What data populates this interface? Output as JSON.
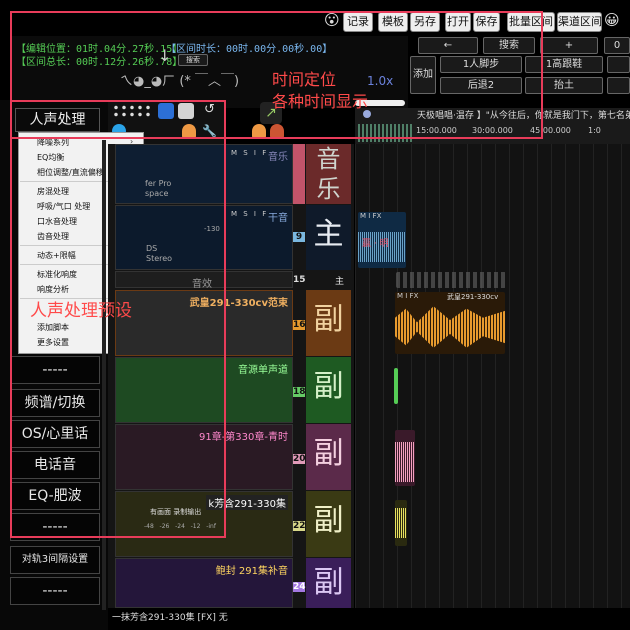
{
  "toolbar": {
    "buttons": [
      "记录",
      "模板",
      "另存",
      "打开",
      "保存",
      "批量区间",
      "渠道区间"
    ],
    "emoji_left": "😮",
    "emoji_right": "😀"
  },
  "info": {
    "edit_pos": "【编辑位置：01时.04分.27秒.15】",
    "interval_len": "【区间时长：00时.00分.00秒.00】",
    "total_len": "【区间总长：00时.12分.26秒.78】",
    "search_small": "搜索",
    "kaomoji": "ㄟ◕_◕ㄏ  (* ￣︿￣)",
    "speed": "1.0x"
  },
  "controls": {
    "left_arrow": "←",
    "search": "搜索",
    "plus": "+",
    "cut_label": "0",
    "add": "添加",
    "row1": [
      "1人脚步",
      "1高跟鞋"
    ],
    "row2": [
      "后退2",
      "抬土"
    ]
  },
  "ruler": {
    "banner": "天极唱唱·温存 】\"从今往后，你就是我门下，第七名弟",
    "ticks": [
      "15:00.000",
      "30:00.000",
      "45:00.000",
      "1:0"
    ]
  },
  "side_menu": {
    "title": "人声处理",
    "items": [
      {
        "label": "降噪系列",
        "arrow": "›"
      },
      {
        "label": "EQ均衡",
        "arrow": "›"
      },
      {
        "label": "相位调整/直流偏移",
        "arrow": ""
      },
      {
        "label": "房混处理",
        "arrow": "›"
      },
      {
        "label": "呼吸/气口 处理",
        "arrow": "›"
      },
      {
        "label": "口水音处理",
        "arrow": "›"
      },
      {
        "label": "齿音处理",
        "arrow": "›"
      },
      {
        "label": "动态+限幅",
        "arrow": "›"
      },
      {
        "label": "标准化响度",
        "arrow": ""
      },
      {
        "label": "响度分析",
        "arrow": ""
      },
      {
        "label": "添加脚本",
        "arrow": ""
      },
      {
        "label": "更多设置",
        "arrow": "›"
      }
    ],
    "buttons": [
      "-----",
      "频谱/切换",
      "OS/心里话",
      "电话音",
      "EQ-肥波",
      "-----",
      "对轨3间隔设置",
      "-----"
    ]
  },
  "tracks": [
    {
      "name": "音乐",
      "num": "",
      "glyph": "音乐",
      "color": "#6b2a2a",
      "glyph_color": "#cfd5cf"
    },
    {
      "name": "干音",
      "num": "9",
      "glyph": "主",
      "color": "#0f1a2a",
      "glyph_color": "#e8ecf2",
      "sub": [
        "-130",
        "DS",
        "Stereo"
      ]
    },
    {
      "name": "音效",
      "num": "15",
      "glyph": "主",
      "color": "#2a2a2a",
      "glyph_color": "#eee"
    },
    {
      "name": "武皇291-330cv范束",
      "num": "16",
      "glyph": "副",
      "color": "#6b3a14",
      "glyph_color": "#f1d2a0"
    },
    {
      "name": "音源单声道",
      "num": "18",
      "glyph": "副",
      "color": "#1e5a22",
      "glyph_color": "#d4f0c8"
    },
    {
      "name": "91章-第330章-青时",
      "num": "20",
      "glyph": "副",
      "color": "#5b2a4a",
      "glyph_color": "#f4d0e0"
    },
    {
      "name": "k芳含291-330集",
      "num": "22",
      "glyph": "副",
      "color": "#3a3a14",
      "glyph_color": "#f0f0c8",
      "sub": [
        "有画面 录制输出",
        "-48",
        "-26",
        "-24",
        "-12",
        "-inf"
      ]
    },
    {
      "name": "鲍封 291集补音",
      "num": "24",
      "glyph": "副",
      "color": "#3a1e5a",
      "glyph_color": "#dcc8f4"
    }
  ],
  "lanes": {
    "clip_label_16": "武皇291-330cv",
    "track_left_labels": [
      "fer Pro",
      "space"
    ],
    "fx": "M I FX"
  },
  "status": {
    "footer": "一抹芳含291-330集 [FX] 无"
  },
  "annotations": {
    "time_pos": "时间定位",
    "time_show": "各种时间显示",
    "preset": "人声处理预设"
  },
  "colors": {
    "accent_red": "#e83c5a",
    "info_green": "#5c5",
    "wave_orange": "#e79a2e",
    "wave_blue": "#7ab7df"
  }
}
